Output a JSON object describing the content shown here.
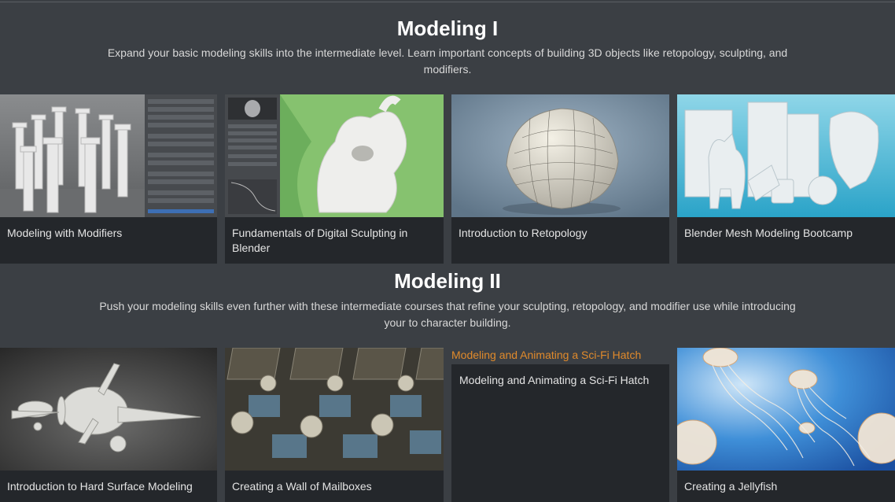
{
  "sections": [
    {
      "title": "Modeling I",
      "description": "Expand your basic modeling skills into the intermediate level. Learn important concepts of building 3D objects like retopology, sculpting, and modifiers.",
      "courses": [
        {
          "title": "Modeling with Modifiers"
        },
        {
          "title": "Fundamentals of Digital Sculpting in Blender"
        },
        {
          "title": "Introduction to Retopology"
        },
        {
          "title": "Blender Mesh Modeling Bootcamp"
        }
      ]
    },
    {
      "title": "Modeling II",
      "description": "Push your modeling skills even further with these intermediate courses that refine your sculpting, retopology, and modifier use while introducing your to character building.",
      "courses": [
        {
          "title": "Introduction to Hard Surface Modeling"
        },
        {
          "title": "Creating a Wall of Mailboxes"
        },
        {
          "title": "Modeling and Animating a Sci-Fi Hatch",
          "link_text": "Modeling and Animating a Sci-Fi Hatch"
        },
        {
          "title": "Creating a Jellyfish"
        }
      ]
    }
  ],
  "colors": {
    "page_bg": "#3b3f44",
    "card_bg": "#24272b",
    "link_accent": "#e08a2b"
  }
}
